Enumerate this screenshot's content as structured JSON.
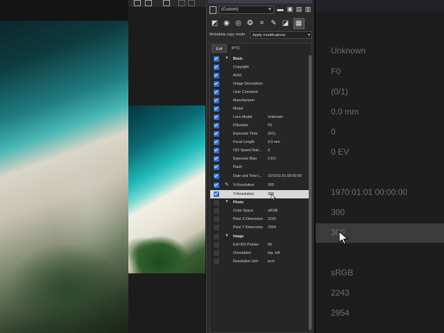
{
  "preset": {
    "value": "(Custom)"
  },
  "metadata_copy": {
    "label": "Metadata copy mode",
    "value": "Apply modifications"
  },
  "tabs": [
    {
      "label": "Exif"
    },
    {
      "label": "IPTC"
    }
  ],
  "rows": [
    {
      "label": "Basic",
      "value": "",
      "group": true,
      "checked": true
    },
    {
      "label": "Copyright",
      "value": "",
      "checked": true
    },
    {
      "label": "Artist",
      "value": "",
      "checked": true
    },
    {
      "label": "Image Description",
      "value": "",
      "checked": true
    },
    {
      "label": "User Comment",
      "value": "",
      "checked": true
    },
    {
      "label": "Manufacturer",
      "value": "",
      "checked": true
    },
    {
      "label": "Model",
      "value": "",
      "checked": true
    },
    {
      "label": "Lens Model",
      "value": "Unknown",
      "checked": true
    },
    {
      "label": "FNumber",
      "value": "F0",
      "checked": true
    },
    {
      "label": "Exposure Time",
      "value": "(0/1)",
      "checked": true
    },
    {
      "label": "Focal Length",
      "value": "0.0 mm",
      "checked": true
    },
    {
      "label": "ISO Speed Rati...",
      "value": "0",
      "checked": true
    },
    {
      "label": "Exposure Bias",
      "value": "0 EV",
      "checked": true
    },
    {
      "label": "Flash",
      "value": "",
      "checked": true
    },
    {
      "label": "Date and Time (...",
      "value": "1970:01:01 00:00:00",
      "checked": true
    },
    {
      "label": "X-Resolution",
      "value": "300",
      "checked": true
    },
    {
      "label": "Y-Resolution",
      "value": "300",
      "checked": true,
      "selected": true
    },
    {
      "label": "Photo",
      "value": "",
      "group": true,
      "checked": false
    },
    {
      "label": "Color Space",
      "value": "sRGB",
      "checked": false
    },
    {
      "label": "Pixel X Dimension",
      "value": "2243",
      "checked": false
    },
    {
      "label": "Pixel Y Dimension",
      "value": "2954",
      "checked": false
    },
    {
      "label": "Image",
      "value": "",
      "group": true,
      "checked": false
    },
    {
      "label": "Exif IFD Pointer",
      "value": "90",
      "checked": false
    },
    {
      "label": "Orientation",
      "value": "top, left",
      "checked": false
    },
    {
      "label": "Resolution Unit",
      "value": "inch",
      "checked": false
    }
  ],
  "zoom_values": [
    "Unknown",
    "F0",
    "(0/1)",
    "0.0 mm",
    "0",
    "0 EV",
    "1970:01:01 00:00:00",
    "300",
    "300",
    "sRGB",
    "2243",
    "2954"
  ],
  "colors": {
    "checkbox": "#2f6fd1",
    "selected_row": "#d9d9d9",
    "panel": "#2b2b2b"
  }
}
